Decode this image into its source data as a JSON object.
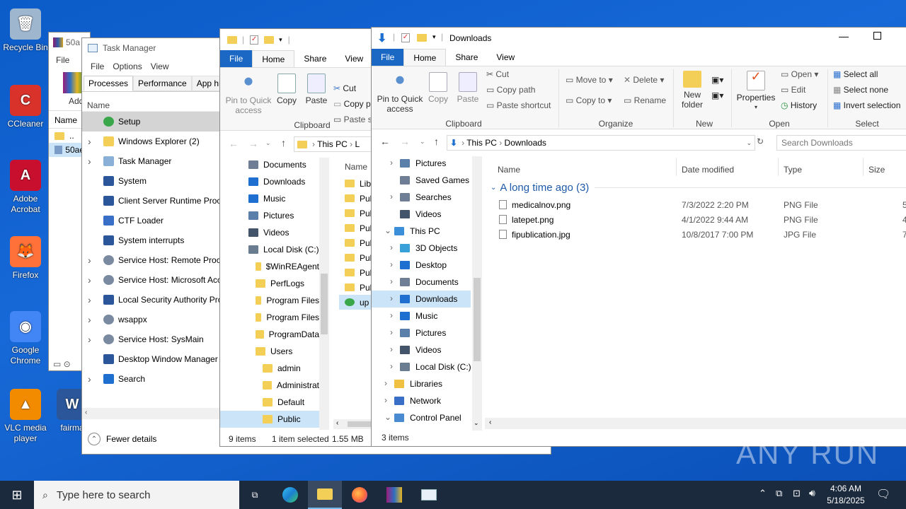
{
  "desktop": {
    "icons": [
      {
        "label": "Recycle Bin",
        "color": "#9fb6cf",
        "glyph": "🗑"
      },
      {
        "label": "CCleaner",
        "color": "#d8322b",
        "glyph": "C"
      },
      {
        "label": "Adobe Acrobat",
        "color": "#c8102e",
        "glyph": "A"
      },
      {
        "label": "Firefox",
        "color": "#ff7139",
        "glyph": "🦊"
      },
      {
        "label": "Google Chrome",
        "color": "#4285f4",
        "glyph": "◉"
      },
      {
        "label": "VLC media player",
        "color": "#f28b00",
        "glyph": "▲"
      },
      {
        "label": "fairma",
        "color": "#2b579a",
        "glyph": "W"
      }
    ]
  },
  "archive_window": {
    "title": "50a",
    "menu_file": "File",
    "col_name": "Name",
    "item_up": "..",
    "item_file": "50ae",
    "add_label": "Add"
  },
  "task_manager": {
    "title": "Task Manager",
    "menu": [
      "File",
      "Options",
      "View"
    ],
    "tabs": [
      "Processes",
      "Performance",
      "App hist"
    ],
    "col_name": "Name",
    "processes": [
      {
        "name": "Setup",
        "expand": false,
        "selected": true,
        "icon": "setup"
      },
      {
        "name": "Windows Explorer (2)",
        "expand": true,
        "icon": "folder"
      },
      {
        "name": "Task Manager",
        "expand": true,
        "icon": "taskmgr"
      },
      {
        "name": "System",
        "expand": false,
        "icon": "window"
      },
      {
        "name": "Client Server Runtime Proce",
        "expand": false,
        "icon": "window"
      },
      {
        "name": "CTF Loader",
        "expand": false,
        "icon": "pen"
      },
      {
        "name": "System interrupts",
        "expand": false,
        "icon": "window"
      },
      {
        "name": "Service Host: Remote Proce",
        "expand": true,
        "icon": "gear"
      },
      {
        "name": "Service Host: Microsoft Acc",
        "expand": true,
        "icon": "gear"
      },
      {
        "name": "Local Security Authority Pro",
        "expand": true,
        "icon": "window"
      },
      {
        "name": "wsappx",
        "expand": true,
        "icon": "gear"
      },
      {
        "name": "Service Host: SysMain",
        "expand": true,
        "icon": "gear"
      },
      {
        "name": "Desktop Window Manager",
        "expand": false,
        "icon": "window"
      },
      {
        "name": "Search",
        "expand": true,
        "icon": "search"
      }
    ],
    "fewer_details": "Fewer details"
  },
  "explorer1": {
    "tabs": [
      "File",
      "Home",
      "Share",
      "View"
    ],
    "ribbon": {
      "pin": "Pin to Quick access",
      "copy": "Copy",
      "paste": "Paste",
      "cut": "Cut",
      "copy_path": "Copy p",
      "paste_shortcut": "Paste s",
      "group": "Clipboard"
    },
    "address": [
      "This PC",
      "L"
    ],
    "nav": [
      {
        "label": "Documents",
        "indent": 0,
        "icon": "docs"
      },
      {
        "label": "Downloads",
        "indent": 0,
        "icon": "down"
      },
      {
        "label": "Music",
        "indent": 0,
        "icon": "music"
      },
      {
        "label": "Pictures",
        "indent": 0,
        "icon": "pics"
      },
      {
        "label": "Videos",
        "indent": 0,
        "icon": "vid"
      },
      {
        "label": "Local Disk (C:)",
        "indent": 0,
        "icon": "disk"
      },
      {
        "label": "$WinREAgent",
        "indent": 1,
        "icon": "folder"
      },
      {
        "label": "PerfLogs",
        "indent": 1,
        "icon": "folder"
      },
      {
        "label": "Program Files",
        "indent": 1,
        "icon": "folder"
      },
      {
        "label": "Program Files",
        "indent": 1,
        "icon": "folder"
      },
      {
        "label": "ProgramData",
        "indent": 1,
        "icon": "folder"
      },
      {
        "label": "Users",
        "indent": 1,
        "icon": "folder"
      },
      {
        "label": "admin",
        "indent": 2,
        "icon": "folder"
      },
      {
        "label": "Administrat",
        "indent": 2,
        "icon": "folder"
      },
      {
        "label": "Default",
        "indent": 2,
        "icon": "folder"
      },
      {
        "label": "Public",
        "indent": 2,
        "icon": "folder",
        "selected": true
      }
    ],
    "col_name": "Name",
    "files": [
      "Lib",
      "Pul",
      "Pul",
      "Pul",
      "Pul",
      "Pul",
      "Pul",
      "Pul",
      "up"
    ],
    "status_items": "9 items",
    "status_selected": "1 item selected",
    "status_size": "1.55 MB"
  },
  "explorer2": {
    "title": "Downloads",
    "tabs": [
      "File",
      "Home",
      "Share",
      "View"
    ],
    "ribbon": {
      "pin": "Pin to Quick access",
      "copy": "Copy",
      "paste": "Paste",
      "cut": "Cut",
      "copy_path": "Copy path",
      "paste_shortcut": "Paste shortcut",
      "clipboard": "Clipboard",
      "move_to": "Move to",
      "copy_to": "Copy to",
      "delete": "Delete",
      "rename": "Rename",
      "organize": "Organize",
      "new_folder": "New folder",
      "new": "New",
      "properties": "Properties",
      "open": "Open",
      "edit": "Edit",
      "history": "History",
      "open_group": "Open",
      "select_all": "Select all",
      "select_none": "Select none",
      "invert": "Invert selection",
      "select_group": "Select"
    },
    "address": [
      "This PC",
      "Downloads"
    ],
    "search_placeholder": "Search Downloads",
    "nav": [
      {
        "label": "Pictures",
        "arrow": "›",
        "indent": 1,
        "icon": "pics"
      },
      {
        "label": "Saved Games",
        "arrow": "",
        "indent": 1,
        "icon": "games"
      },
      {
        "label": "Searches",
        "arrow": "›",
        "indent": 1,
        "icon": "search"
      },
      {
        "label": "Videos",
        "arrow": "",
        "indent": 1,
        "icon": "vid"
      },
      {
        "label": "This PC",
        "arrow": "⌄",
        "indent": 0,
        "icon": "pc"
      },
      {
        "label": "3D Objects",
        "arrow": "›",
        "indent": 1,
        "icon": "3d"
      },
      {
        "label": "Desktop",
        "arrow": "›",
        "indent": 1,
        "icon": "desk"
      },
      {
        "label": "Documents",
        "arrow": "›",
        "indent": 1,
        "icon": "docs"
      },
      {
        "label": "Downloads",
        "arrow": "›",
        "indent": 1,
        "icon": "down",
        "selected": true
      },
      {
        "label": "Music",
        "arrow": "›",
        "indent": 1,
        "icon": "music"
      },
      {
        "label": "Pictures",
        "arrow": "›",
        "indent": 1,
        "icon": "pics"
      },
      {
        "label": "Videos",
        "arrow": "›",
        "indent": 1,
        "icon": "vid"
      },
      {
        "label": "Local Disk (C:)",
        "arrow": "›",
        "indent": 1,
        "icon": "disk"
      },
      {
        "label": "Libraries",
        "arrow": "›",
        "indent": 0,
        "icon": "lib"
      },
      {
        "label": "Network",
        "arrow": "›",
        "indent": 0,
        "icon": "net"
      },
      {
        "label": "Control Panel",
        "arrow": "⌄",
        "indent": 0,
        "icon": "cp"
      }
    ],
    "columns": [
      "Name",
      "Date modified",
      "Type",
      "Size"
    ],
    "group_label": "A long time ago (3)",
    "files": [
      {
        "name": "medicalnov.png",
        "date": "7/3/2022 2:20 PM",
        "type": "PNG File",
        "size": "5"
      },
      {
        "name": "latepet.png",
        "date": "4/1/2022 9:44 AM",
        "type": "PNG File",
        "size": "4"
      },
      {
        "name": "fipublication.jpg",
        "date": "10/8/2017 7:00 PM",
        "type": "JPG File",
        "size": "7"
      }
    ],
    "status_items": "3 items"
  },
  "taskbar": {
    "search_placeholder": "Type here to search",
    "time": "4:06 AM",
    "date": "5/18/2025"
  },
  "watermark": "ANY RUN"
}
